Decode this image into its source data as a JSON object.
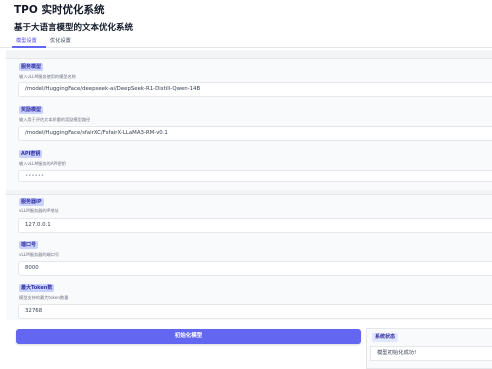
{
  "app": {
    "title": "TPO 实时优化系统",
    "subtitle": "基于大语言模型的文本优化系统"
  },
  "tabs": [
    {
      "label": "模型设置",
      "active": true
    },
    {
      "label": "优化设置",
      "active": false
    }
  ],
  "fields": {
    "service_model": {
      "label": "服务模型",
      "hint": "输入vLLM服务使用的模型名称",
      "value": "/model/HuggingFace/deepseek-ai/DeepSeek-R1-Distill-Qwen-14B"
    },
    "reward_model": {
      "label": "奖励模型",
      "hint": "输入用于评估文本质量的奖励模型路径",
      "value": "/model/HuggingFace/sfairXC/FsfairX-LLaMA3-RM-v0.1"
    },
    "api_key": {
      "label": "API密钥",
      "hint": "输入vLLM服务的API密钥",
      "value": "••••••"
    },
    "service_ip": {
      "label": "服务器IP",
      "hint": "vLLM服务器的IP地址",
      "value": "127.0.0.1"
    },
    "port": {
      "label": "端口号",
      "hint": "vLLM服务器的端口号",
      "value": "8000"
    },
    "max_tokens": {
      "label": "最大Token数",
      "hint": "模型支持的最大token数量",
      "value": "32768"
    }
  },
  "actions": {
    "init_label": "初始化模型"
  },
  "status": {
    "label": "系统状态",
    "value": "模型初始化成功!"
  },
  "colors": {
    "accent": "#6366f1",
    "badge_bg": "#c7d2fe",
    "badge_text": "#3730a3"
  }
}
